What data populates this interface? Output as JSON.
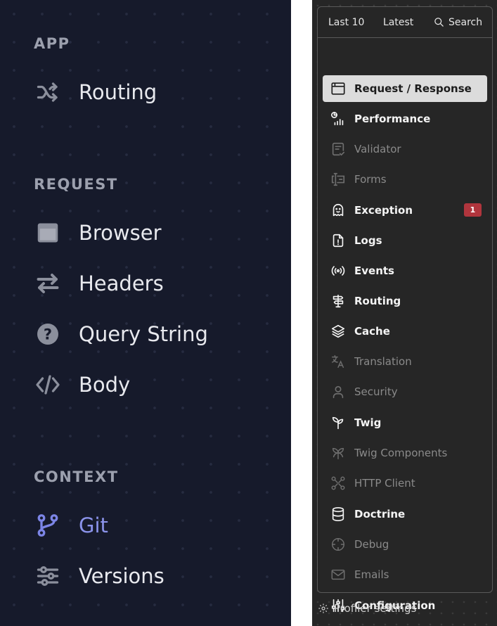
{
  "left": {
    "sections": [
      {
        "label": "APP",
        "items": [
          {
            "label": "Routing",
            "icon": "shuffle-icon"
          }
        ]
      },
      {
        "label": "REQUEST",
        "items": [
          {
            "label": "Browser",
            "icon": "browser-window-icon"
          },
          {
            "label": "Headers",
            "icon": "arrows-left-right-icon"
          },
          {
            "label": "Query String",
            "icon": "question-circle-icon"
          },
          {
            "label": "Body",
            "icon": "code-icon"
          }
        ]
      },
      {
        "label": "CONTEXT",
        "items": [
          {
            "label": "Git",
            "icon": "git-branch-icon",
            "active": true
          },
          {
            "label": "Versions",
            "icon": "sliders-icon"
          }
        ]
      }
    ],
    "active_color": "#8b93ea"
  },
  "right": {
    "tabs": {
      "last10": "Last 10",
      "latest": "Latest",
      "search": "Search"
    },
    "menu": [
      {
        "label": "Request / Response",
        "icon": "request-response-icon",
        "state": "selected"
      },
      {
        "label": "Performance",
        "icon": "performance-icon",
        "state": "enabled"
      },
      {
        "label": "Validator",
        "icon": "validator-icon",
        "state": "disabled"
      },
      {
        "label": "Forms",
        "icon": "forms-icon",
        "state": "disabled"
      },
      {
        "label": "Exception",
        "icon": "exception-ghost-icon",
        "state": "enabled",
        "badge": "1"
      },
      {
        "label": "Logs",
        "icon": "logs-icon",
        "state": "enabled"
      },
      {
        "label": "Events",
        "icon": "events-broadcast-icon",
        "state": "enabled"
      },
      {
        "label": "Routing",
        "icon": "signpost-icon",
        "state": "enabled"
      },
      {
        "label": "Cache",
        "icon": "layers-icon",
        "state": "enabled"
      },
      {
        "label": "Translation",
        "icon": "translation-icon",
        "state": "disabled"
      },
      {
        "label": "Security",
        "icon": "user-icon",
        "state": "disabled"
      },
      {
        "label": "Twig",
        "icon": "sprout-icon",
        "state": "enabled"
      },
      {
        "label": "Twig Components",
        "icon": "twig-components-icon",
        "state": "disabled"
      },
      {
        "label": "HTTP Client",
        "icon": "http-client-icon",
        "state": "disabled"
      },
      {
        "label": "Doctrine",
        "icon": "database-icon",
        "state": "enabled"
      },
      {
        "label": "Debug",
        "icon": "crosshair-icon",
        "state": "disabled"
      },
      {
        "label": "Emails",
        "icon": "mail-icon",
        "state": "disabled"
      },
      {
        "label": "Configuration",
        "icon": "adjustments-icon",
        "state": "enabled"
      }
    ],
    "settings_label": "Profiler settings",
    "badge_color": "#b0353d"
  }
}
